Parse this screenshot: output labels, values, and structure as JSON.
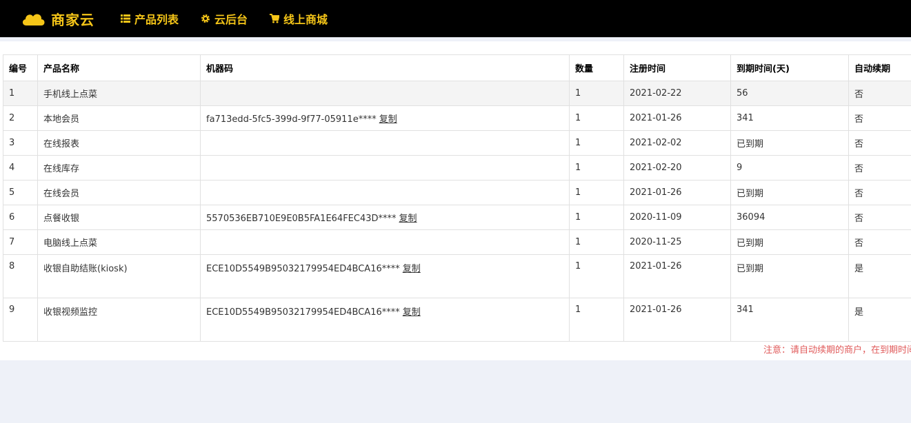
{
  "brand": {
    "name": "商家云"
  },
  "nav": [
    {
      "label": "产品列表",
      "icon": "list-icon"
    },
    {
      "label": "云后台",
      "icon": "gear-icon"
    },
    {
      "label": "线上商城",
      "icon": "cart-icon"
    }
  ],
  "table": {
    "headers": [
      "编号",
      "产品名称",
      "机器码",
      "数量",
      "注册时间",
      "到期时间(天)",
      "自动续期"
    ],
    "copy_label": "复制",
    "rows": [
      {
        "id": "1",
        "name": "手机线上点菜",
        "code": "",
        "qty": "1",
        "reg": "2021-02-22",
        "expire": "56",
        "auto": "否"
      },
      {
        "id": "2",
        "name": "本地会员",
        "code": "fa713edd-5fc5-399d-9f77-05911e****",
        "qty": "1",
        "reg": "2021-01-26",
        "expire": "341",
        "auto": "否"
      },
      {
        "id": "3",
        "name": "在线报表",
        "code": "",
        "qty": "1",
        "reg": "2021-02-02",
        "expire": "已到期",
        "auto": "否"
      },
      {
        "id": "4",
        "name": "在线库存",
        "code": "",
        "qty": "1",
        "reg": "2021-02-20",
        "expire": "9",
        "auto": "否"
      },
      {
        "id": "5",
        "name": "在线会员",
        "code": "",
        "qty": "1",
        "reg": "2021-01-26",
        "expire": "已到期",
        "auto": "否"
      },
      {
        "id": "6",
        "name": "点餐收银",
        "code": "5570536EB710E9E0B5FA1E64FEC43D****",
        "qty": "1",
        "reg": "2020-11-09",
        "expire": "36094",
        "auto": "否"
      },
      {
        "id": "7",
        "name": "电脑线上点菜",
        "code": "",
        "qty": "1",
        "reg": "2020-11-25",
        "expire": "已到期",
        "auto": "否"
      },
      {
        "id": "8",
        "name": "收银自助结账(kiosk)",
        "code": "ECE10D5549B95032179954ED4BCA16****",
        "qty": "1",
        "reg": "2021-01-26",
        "expire": "已到期",
        "auto": "是"
      },
      {
        "id": "9",
        "name": "收银视频监控",
        "code": "ECE10D5549B95032179954ED4BCA16****",
        "qty": "1",
        "reg": "2021-01-26",
        "expire": "341",
        "auto": "是"
      }
    ]
  },
  "note": "注意：请自动续期的商户，在到期时间",
  "colors": {
    "accent": "#f5c518",
    "expired": "#e02020",
    "note": "#e05a5a"
  }
}
